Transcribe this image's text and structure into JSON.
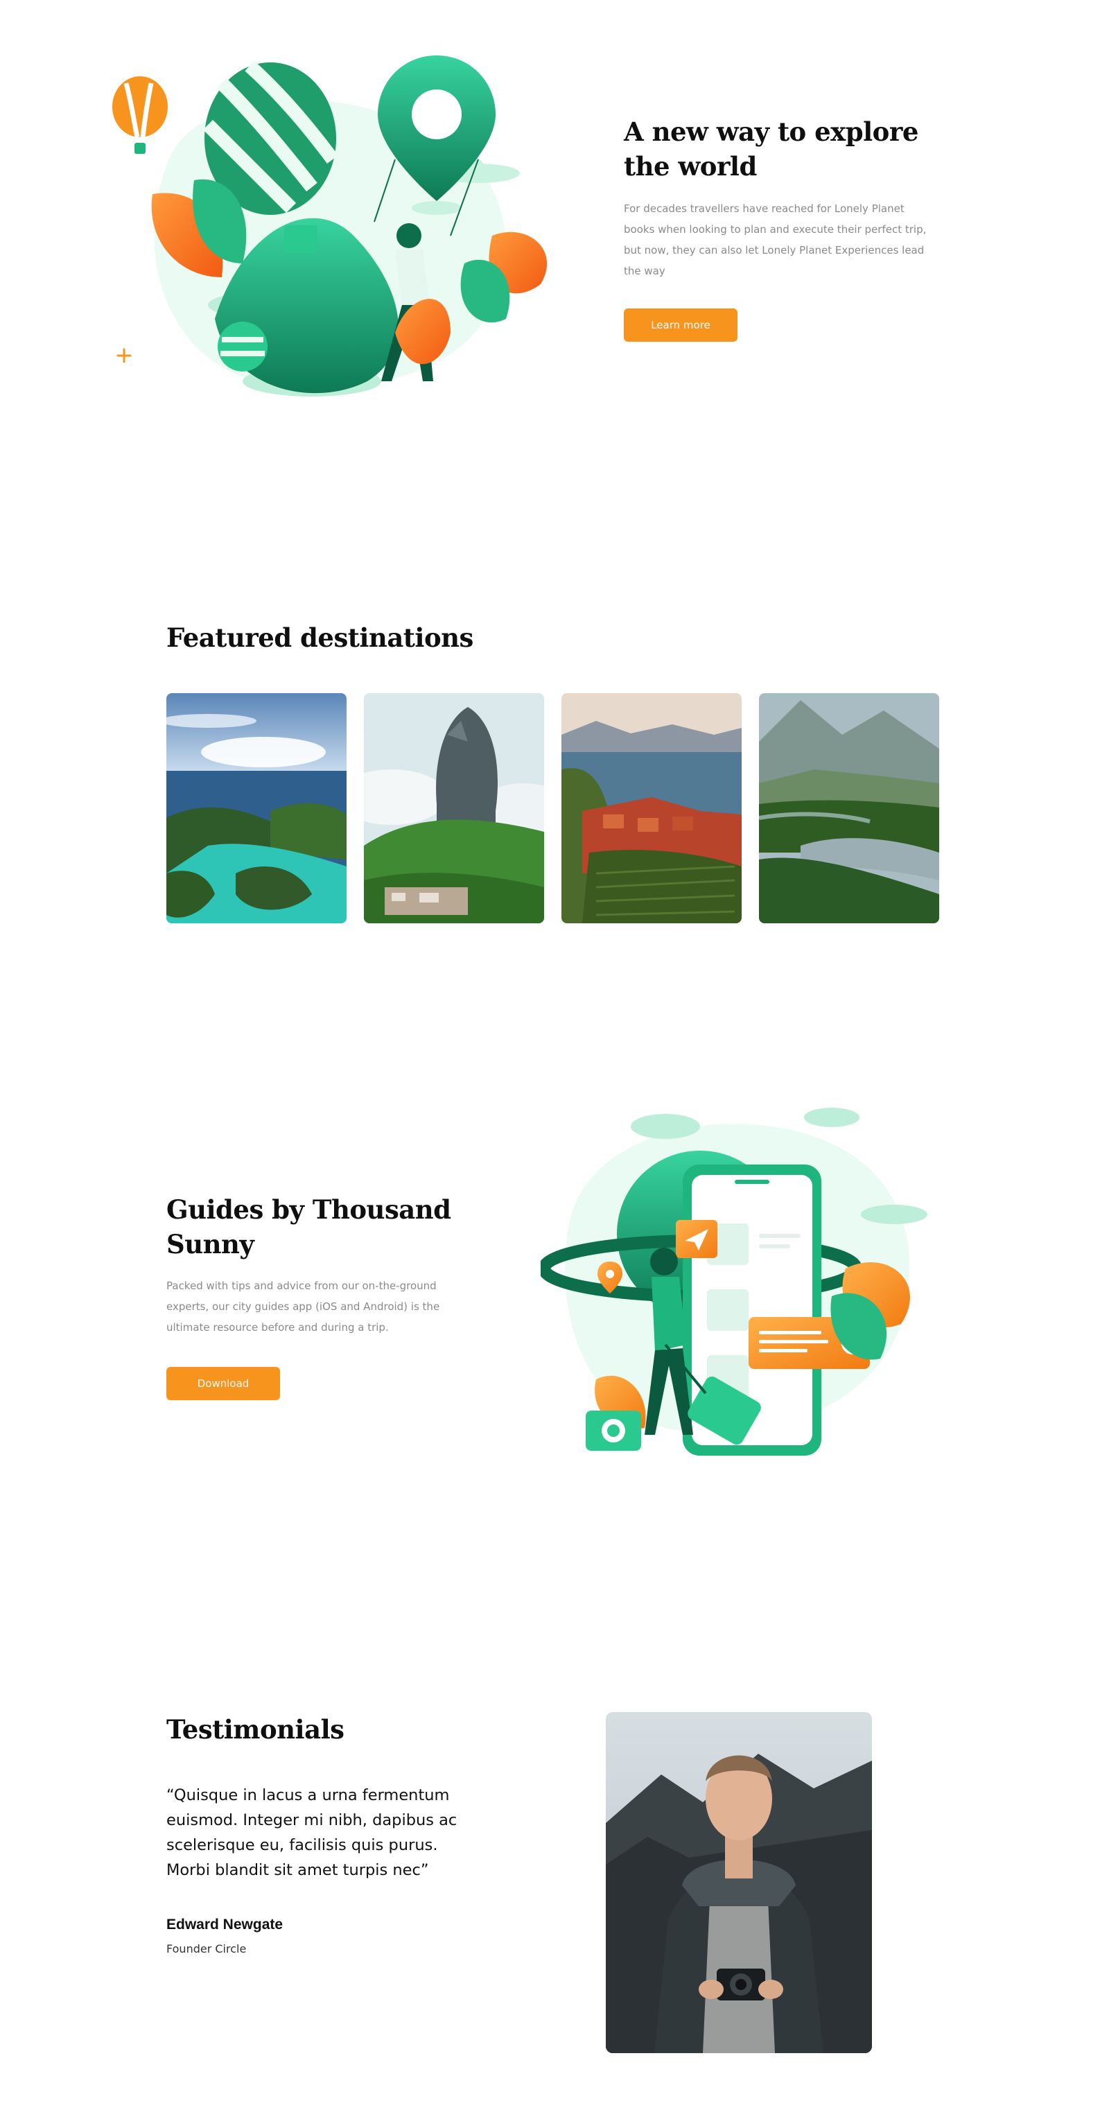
{
  "hero": {
    "title": "A new way to explore the world",
    "body": "For decades travellers have reached for Lonely Planet books when looking to plan and execute their perfect trip, but now, they can also let Lonely Planet Experiences lead the way",
    "button_label": "Learn more"
  },
  "featured": {
    "title": "Featured destinations",
    "images": [
      {
        "name": "tropical-islands-photo"
      },
      {
        "name": "mountain-peak-photo"
      },
      {
        "name": "lakeside-village-photo"
      },
      {
        "name": "river-valley-photo"
      }
    ]
  },
  "guides": {
    "title": "Guides by Thousand Sunny",
    "body": "Packed with tips and advice from our on-the-ground experts, our city guides app (iOS and Android) is the ultimate resource before and during a trip.",
    "button_label": "Download"
  },
  "testimonials": {
    "title": "Testimonials",
    "quote": "“Quisque in lacus a urna fermentum euismod. Integer mi nibh, dapibus ac scelerisque eu, facilisis quis purus. Morbi blandit sit amet turpis nec”",
    "author": "Edward Newgate",
    "role": "Founder Circle"
  },
  "colors": {
    "accent": "#f7941e",
    "green": "#1fb57f",
    "dark_green": "#0d6e4c",
    "heading": "#0f0f0f",
    "muted": "#8a8a8a"
  }
}
